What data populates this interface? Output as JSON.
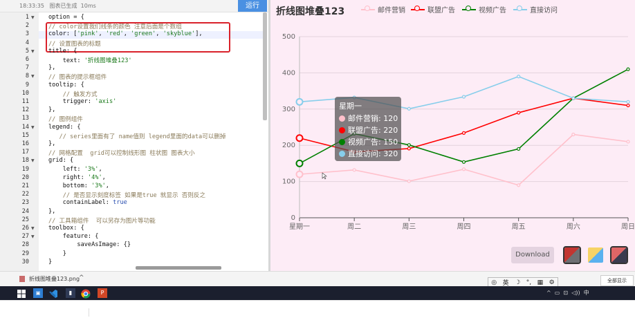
{
  "editor": {
    "status": "18:33:35   图表已生成  10ms",
    "run_label": "运行",
    "line_numbers": [
      "1",
      "2",
      "3",
      "4",
      "5",
      "6",
      "7",
      "8",
      "9",
      "10",
      "11",
      "12",
      "13",
      "14",
      "15",
      "16",
      "17",
      "18",
      "19",
      "20",
      "21",
      "22",
      "23",
      "24",
      "25",
      "26",
      "27",
      "28",
      "29",
      "30"
    ],
    "fold_lines": [
      "1",
      "5",
      "8",
      "14",
      "18",
      "26",
      "27"
    ],
    "lines": [
      [
        {
          "t": "option = {",
          "c": "p"
        }
      ],
      [
        {
          "t": "// color设置我们线条的颜色 注意后面是个数组",
          "c": "comment"
        }
      ],
      [
        {
          "t": "color: [",
          "c": "p"
        },
        {
          "t": "'pink'",
          "c": "str"
        },
        {
          "t": ", ",
          "c": "p"
        },
        {
          "t": "'red'",
          "c": "str"
        },
        {
          "t": ", ",
          "c": "p"
        },
        {
          "t": "'green'",
          "c": "str"
        },
        {
          "t": ", ",
          "c": "p"
        },
        {
          "t": "'skyblue'",
          "c": "str"
        },
        {
          "t": "],",
          "c": "p"
        }
      ],
      [
        {
          "t": "// 设置图表的标题",
          "c": "comment"
        }
      ],
      [
        {
          "t": "title: {",
          "c": "p"
        }
      ],
      [
        {
          "t": "    text: ",
          "c": "p"
        },
        {
          "t": "'折线图堆叠123'",
          "c": "str"
        }
      ],
      [
        {
          "t": "},",
          "c": "p"
        }
      ],
      [
        {
          "t": "// 图表的提示框组件",
          "c": "comment"
        }
      ],
      [
        {
          "t": "tooltip: {",
          "c": "p"
        }
      ],
      [
        {
          "t": "    // 触发方式",
          "c": "comment"
        }
      ],
      [
        {
          "t": "    trigger: ",
          "c": "p"
        },
        {
          "t": "'axis'",
          "c": "str"
        }
      ],
      [
        {
          "t": "},",
          "c": "p"
        }
      ],
      [
        {
          "t": "// 图例组件",
          "c": "comment"
        }
      ],
      [
        {
          "t": "legend: {",
          "c": "p"
        }
      ],
      [
        {
          "t": "   // series里面有了 name值则 legend里面的data可以删掉",
          "c": "comment"
        }
      ],
      [
        {
          "t": "},",
          "c": "p"
        }
      ],
      [
        {
          "t": "// 网格配置  grid可以控制线形图 柱状图 图表大小",
          "c": "comment"
        }
      ],
      [
        {
          "t": "grid: {",
          "c": "p"
        }
      ],
      [
        {
          "t": "    left: ",
          "c": "p"
        },
        {
          "t": "'3%'",
          "c": "str"
        },
        {
          "t": ",",
          "c": "p"
        }
      ],
      [
        {
          "t": "    right: ",
          "c": "p"
        },
        {
          "t": "'4%'",
          "c": "str"
        },
        {
          "t": ",",
          "c": "p"
        }
      ],
      [
        {
          "t": "    bottom: ",
          "c": "p"
        },
        {
          "t": "'3%'",
          "c": "str"
        },
        {
          "t": ",",
          "c": "p"
        }
      ],
      [
        {
          "t": "    // 是否显示刻度标签 如果是true 就显示 否则反之",
          "c": "comment"
        }
      ],
      [
        {
          "t": "    containLabel: ",
          "c": "p"
        },
        {
          "t": "true",
          "c": "kw"
        }
      ],
      [
        {
          "t": "},",
          "c": "p"
        }
      ],
      [
        {
          "t": "// 工具箱组件  可以另存为图片等功能",
          "c": "comment"
        }
      ],
      [
        {
          "t": "toolbox: {",
          "c": "p"
        }
      ],
      [
        {
          "t": "    feature: {",
          "c": "p"
        }
      ],
      [
        {
          "t": "        saveAsImage: {}",
          "c": "p"
        }
      ],
      [
        {
          "t": "    }",
          "c": "p"
        }
      ],
      [
        {
          "t": "}",
          "c": "p"
        }
      ]
    ]
  },
  "chart_panel": {
    "download_label": "Download",
    "theme_colors": [
      [
        "#c23531",
        "#6e7074"
      ],
      [
        "#f6d365",
        "#5ab1ef"
      ],
      [
        "#e06666",
        "#3b3b4f"
      ]
    ]
  },
  "chart_data": {
    "type": "line",
    "title": "折线图堆叠123",
    "categories": [
      "星期一",
      "周二",
      "周三",
      "周四",
      "周五",
      "周六",
      "周日"
    ],
    "ylim": [
      0,
      500
    ],
    "yticks": [
      0,
      100,
      200,
      300,
      400,
      500
    ],
    "grid": true,
    "legend_position": "top",
    "series": [
      {
        "name": "邮件营销",
        "color": "#ffc0cb",
        "values": [
          120,
          132,
          101,
          134,
          90,
          230,
          210
        ]
      },
      {
        "name": "联盟广告",
        "color": "#ff0000",
        "values": [
          220,
          182,
          191,
          234,
          290,
          330,
          310
        ]
      },
      {
        "name": "视频广告",
        "color": "#008000",
        "values": [
          150,
          232,
          201,
          154,
          190,
          330,
          410
        ]
      },
      {
        "name": "直接访问",
        "color": "#87ceeb",
        "values": [
          320,
          332,
          301,
          334,
          390,
          330,
          320
        ]
      }
    ],
    "tooltip": {
      "title": "星期一",
      "rows": [
        "邮件营销: 120",
        "联盟广告: 220",
        "视频广告: 150",
        "直接访问: 320"
      ]
    }
  },
  "downloads_bar": {
    "file_name": "折线图堆叠123.png",
    "ime_chars": [
      "英",
      "☽",
      "°,",
      "▦",
      "⚙"
    ],
    "show_all_label": "全部显示"
  },
  "taskbar": {
    "tray_text": "^  ▭  ⊡  ◁))  中"
  }
}
